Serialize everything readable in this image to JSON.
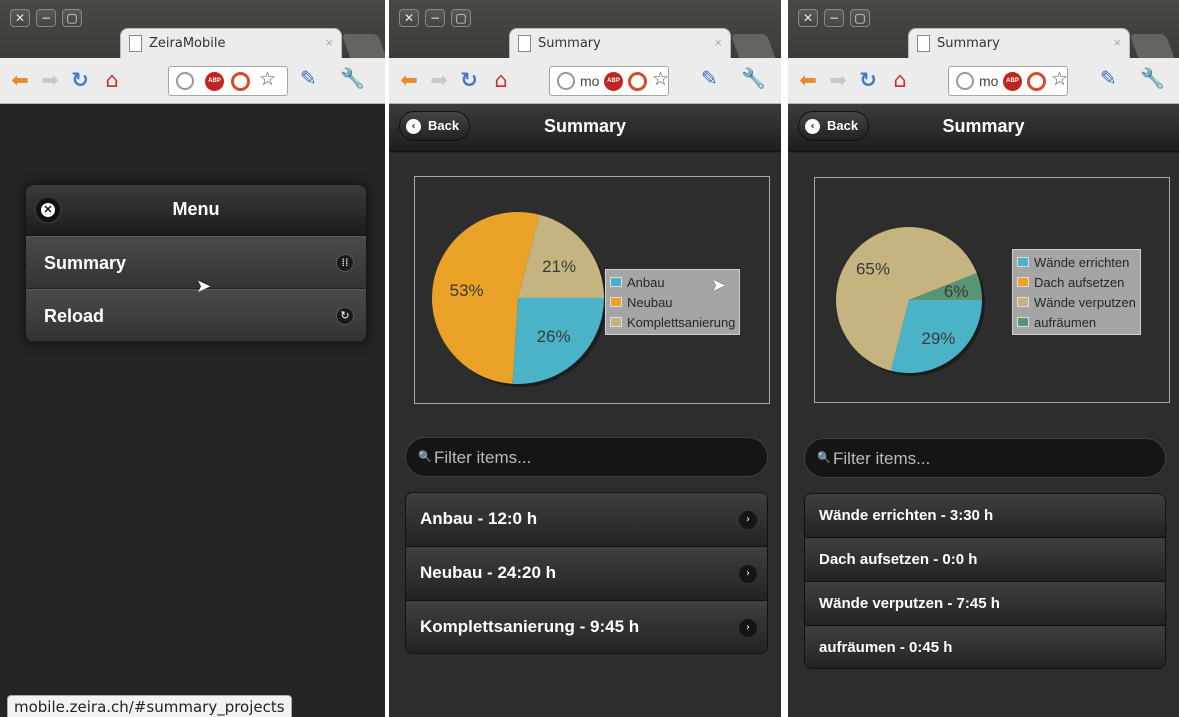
{
  "window_controls": {
    "close": "✕",
    "minimize": "−",
    "maximize": "▢"
  },
  "browser": {
    "close_tab": "×",
    "omnibox_text_short": "mo",
    "star": "☆",
    "adblock_label": "ABP"
  },
  "window1": {
    "tab_title": "ZeiraMobile",
    "menu": {
      "title": "Menu",
      "items": [
        {
          "label": "Summary",
          "icon": "grid-icon"
        },
        {
          "label": "Reload",
          "icon": "refresh-icon"
        }
      ]
    },
    "status_url": "mobile.zeira.ch/#summary_projects"
  },
  "window2": {
    "tab_title": "Summary",
    "back_label": "Back",
    "page_title": "Summary",
    "search_placeholder": "Filter items...",
    "list": [
      "Anbau - 12:0 h",
      "Neubau - 24:20 h",
      "Komplettsanierung - 9:45 h"
    ]
  },
  "window3": {
    "tab_title": "Summary",
    "back_label": "Back",
    "page_title": "Summary",
    "search_placeholder": "Filter items...",
    "list": [
      "Wände errichten - 3:30 h",
      "Dach aufsetzen - 0:0 h",
      "Wände verputzen - 7:45 h",
      "aufräumen - 0:45 h"
    ]
  },
  "colors": {
    "blue": "#4ab3c8",
    "orange": "#eaa228",
    "tan": "#c5b47f",
    "green": "#579575"
  },
  "chart_data": [
    {
      "type": "pie",
      "categories": [
        "Anbau",
        "Neubau",
        "Komplettsanierung"
      ],
      "values": [
        26,
        53,
        21
      ],
      "data_labels": [
        "26%",
        "53%",
        "21%"
      ],
      "legend": "right",
      "colors": [
        "#4ab3c8",
        "#eaa228",
        "#c5b47f"
      ]
    },
    {
      "type": "pie",
      "categories": [
        "Wände errichten",
        "Dach aufsetzen",
        "Wände verputzen",
        "aufräumen"
      ],
      "values": [
        29,
        0,
        65,
        6
      ],
      "data_labels": [
        "29%",
        "",
        "65%",
        "6%"
      ],
      "legend": "right",
      "colors": [
        "#4ab3c8",
        "#eaa228",
        "#c5b47f",
        "#579575"
      ]
    }
  ]
}
